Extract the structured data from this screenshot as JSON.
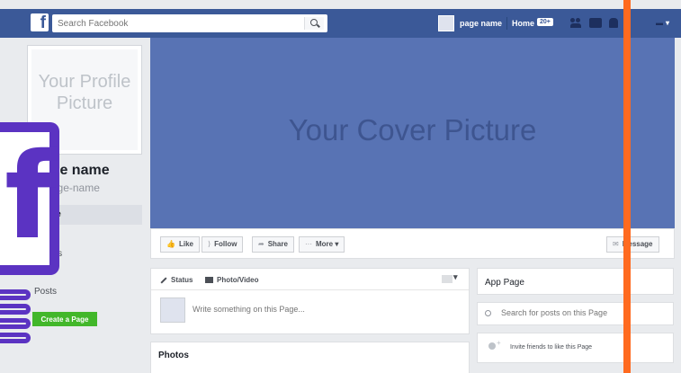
{
  "topbar": {
    "logo": "f",
    "search_placeholder": "Search Facebook",
    "page_name": "page name",
    "home_label": "Home",
    "home_count": "20+"
  },
  "profile": {
    "picture_text": "Your Profile Picture",
    "name": "page name",
    "handle": "@page-name"
  },
  "side_nav": {
    "items": [
      {
        "label": "Home"
      },
      {
        "label": "About"
      },
      {
        "label": "Photos"
      }
    ],
    "posts": "Posts",
    "create_page": "Create a Page"
  },
  "cover": {
    "text": "Your Cover Picture"
  },
  "actions": {
    "like": "Like",
    "follow": "Follow",
    "share": "Share",
    "more": "More ▾",
    "message": "Message"
  },
  "composer": {
    "status_tab": "Status",
    "photo_tab": "Photo/Video",
    "placeholder": "Write something on this Page..."
  },
  "photos": {
    "title": "Photos"
  },
  "right": {
    "app_page": "App Page",
    "search_placeholder": "Search for posts on this Page",
    "invite": "Invite friends to like this Page"
  },
  "colors": {
    "brand_blue": "#3b5998",
    "cover": "#5873b4",
    "create_green": "#42b72a",
    "overlay_orange": "#ff6a1f",
    "overlay_purple": "#5b33c2"
  }
}
